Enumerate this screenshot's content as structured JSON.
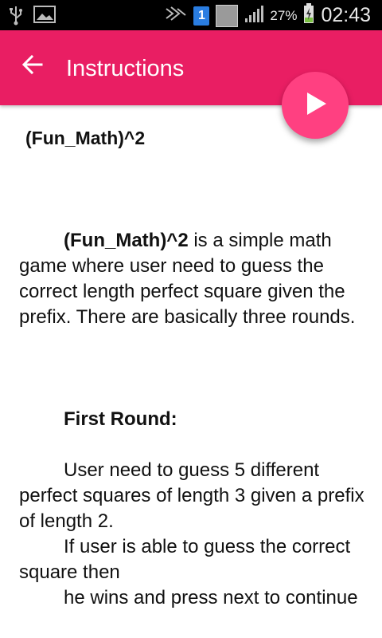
{
  "status_bar": {
    "battery_percent": "27%",
    "time": "02:43",
    "sim_slot": "1",
    "icons": [
      "usb-icon",
      "image-icon",
      "signal-muted-icon",
      "sim-icon",
      "no-signal-icon",
      "signal-icon",
      "battery-charging-icon"
    ]
  },
  "app_bar": {
    "title": "Instructions",
    "back_icon": "arrow-back-icon",
    "color": "#e91e63"
  },
  "fab": {
    "icon": "play-icon",
    "color": "#ff4081"
  },
  "content": {
    "title": "(Fun_Math)^2",
    "intro_bold": "(Fun_Math)^2",
    "intro_text": " is a simple math game where user need to guess the correct length perfect square given the prefix. There are basically three rounds.",
    "round1_heading": "First Round:",
    "round1_line1": "User need to guess 5 different perfect squares of length 3 given a prefix of length 2.",
    "round1_line2": "If user is able to guess the correct square then",
    "round1_line3": "he wins and press next to continue"
  }
}
